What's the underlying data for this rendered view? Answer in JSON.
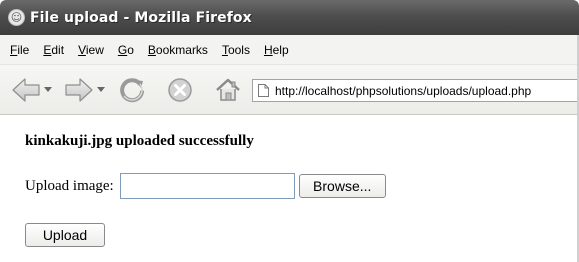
{
  "window": {
    "title": "File upload - Mozilla Firefox",
    "app_icon": "firefox-icon"
  },
  "menubar": {
    "items": [
      "File",
      "Edit",
      "View",
      "Go",
      "Bookmarks",
      "Tools",
      "Help"
    ]
  },
  "toolbar": {
    "icons": [
      "back-arrow-icon",
      "dropdown-arrow-icon",
      "forward-arrow-icon",
      "dropdown-arrow-icon",
      "reload-icon",
      "stop-icon",
      "home-icon",
      "page-icon"
    ],
    "url": "http://localhost/phpsolutions/uploads/upload.php"
  },
  "page": {
    "success_message": "kinkakuji.jpg uploaded successfully",
    "upload_label": "Upload image:",
    "file_input_value": "",
    "browse_label": "Browse...",
    "upload_button_label": "Upload"
  },
  "colors": {
    "titlebar": "#4e4e4e",
    "menubar": "#f3f3f1",
    "page_background": "#ffffff"
  }
}
